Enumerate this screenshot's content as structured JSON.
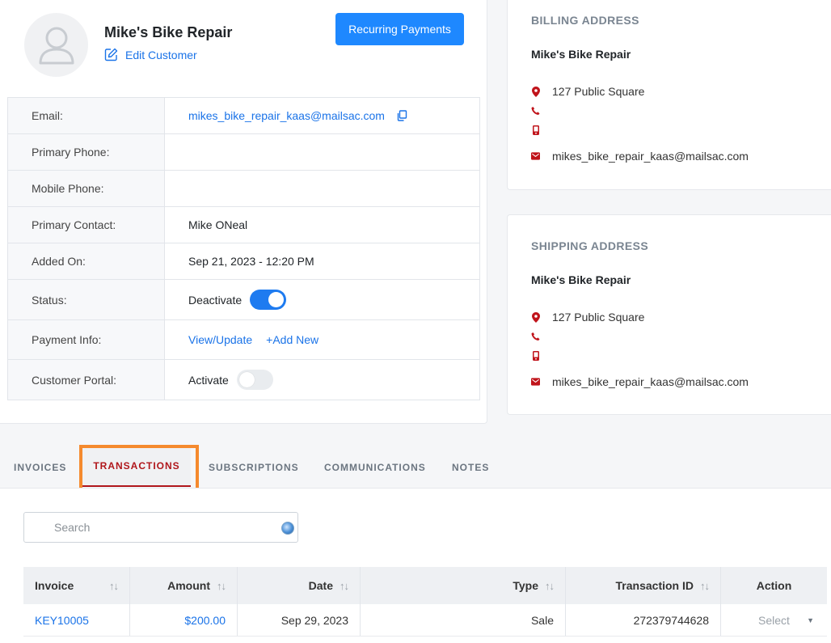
{
  "customer": {
    "name": "Mike's Bike Repair",
    "edit_label": "Edit Customer",
    "recurring_button": "Recurring Payments"
  },
  "info": {
    "email_label": "Email:",
    "email_value": "mikes_bike_repair_kaas@mailsac.com",
    "primary_phone_label": "Primary Phone:",
    "primary_phone_value": "",
    "mobile_phone_label": "Mobile Phone:",
    "mobile_phone_value": "",
    "primary_contact_label": "Primary Contact:",
    "primary_contact_value": "Mike ONeal",
    "added_on_label": "Added On:",
    "added_on_value": "Sep 21, 2023 - 12:20 PM",
    "status_label": "Status:",
    "status_toggle_label": "Deactivate",
    "status_on": true,
    "payment_label": "Payment Info:",
    "payment_view_link": "View/Update",
    "payment_add_link": "+Add New",
    "portal_label": "Customer Portal:",
    "portal_toggle_label": "Activate",
    "portal_on": false
  },
  "billing": {
    "title": "BILLING ADDRESS",
    "name": "Mike's Bike Repair",
    "address": "127 Public Square",
    "phone": "",
    "mobile": "",
    "email": "mikes_bike_repair_kaas@mailsac.com"
  },
  "shipping": {
    "title": "SHIPPING ADDRESS",
    "name": "Mike's Bike Repair",
    "address": "127 Public Square",
    "phone": "",
    "mobile": "",
    "email": "mikes_bike_repair_kaas@mailsac.com"
  },
  "tabs": [
    {
      "label": "INVOICES",
      "active": false
    },
    {
      "label": "TRANSACTIONS",
      "active": true
    },
    {
      "label": "SUBSCRIPTIONS",
      "active": false
    },
    {
      "label": "COMMUNICATIONS",
      "active": false
    },
    {
      "label": "NOTES",
      "active": false
    }
  ],
  "search": {
    "placeholder": "Search",
    "value": ""
  },
  "table": {
    "columns": [
      "Invoice",
      "Amount",
      "Date",
      "Type",
      "Transaction ID",
      "Action"
    ],
    "rows": [
      {
        "invoice": "KEY10005",
        "amount": "$200.00",
        "date": "Sep 29, 2023",
        "type": "Sale",
        "transaction_id": "272379744628",
        "action": "Select"
      }
    ]
  },
  "colors": {
    "primary": "#1e88ff",
    "link": "#1a73e8",
    "accent_red": "#b0161b",
    "highlight": "#f58a2e"
  }
}
